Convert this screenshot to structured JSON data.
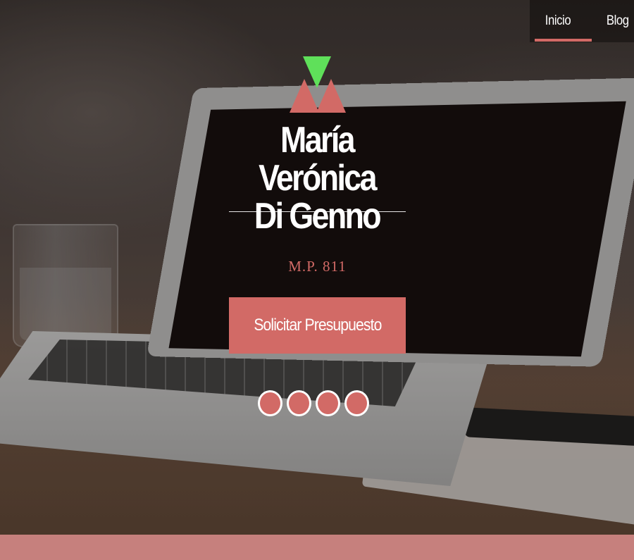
{
  "nav": {
    "items": [
      {
        "label": "Inicio",
        "active": true
      },
      {
        "label": "Blog",
        "active": false
      }
    ]
  },
  "logo": {
    "icon": "triangles-logo-icon"
  },
  "hero": {
    "name_line1": "María Verónica",
    "name_line2": "Di Genno",
    "license": "M.P. 811",
    "cta_label": "Solicitar Presupuesto"
  },
  "slider": {
    "dot_count": 4
  },
  "colors": {
    "accent": "#d26a66",
    "logo_green": "#5fe05a",
    "footer": "#c6807d",
    "text": "#ffffff"
  }
}
